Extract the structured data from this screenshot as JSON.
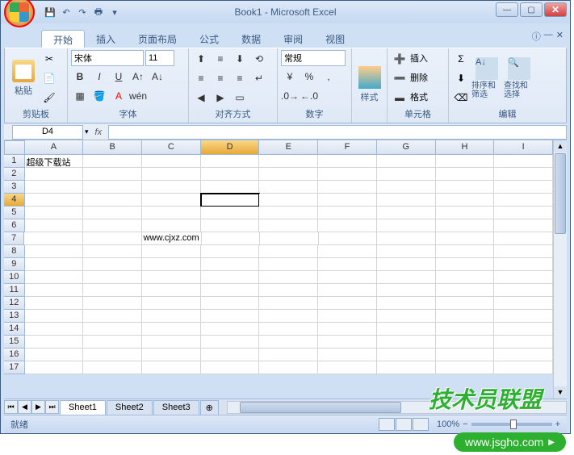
{
  "title": "Book1 - Microsoft Excel",
  "tabs": {
    "home": "开始",
    "insert": "插入",
    "pagelayout": "页面布局",
    "formulas": "公式",
    "data": "数据",
    "review": "审阅",
    "view": "视图"
  },
  "ribbon": {
    "clipboard": {
      "paste": "粘贴",
      "label": "剪贴板"
    },
    "font": {
      "name": "宋体",
      "size": "11",
      "label": "字体"
    },
    "alignment": {
      "label": "对齐方式"
    },
    "number": {
      "format": "常规",
      "label": "数字"
    },
    "styles": {
      "btn": "样式",
      "label": ""
    },
    "cells": {
      "insert": "插入",
      "delete": "删除",
      "format": "格式",
      "label": "单元格"
    },
    "editing": {
      "sort": "排序和筛选",
      "find": "查找和选择",
      "label": "编辑"
    }
  },
  "namebox": "D4",
  "columns": [
    "A",
    "B",
    "C",
    "D",
    "E",
    "F",
    "G",
    "H",
    "I"
  ],
  "row_count": 17,
  "cells": {
    "A1": "超级下载站",
    "C7": "www.cjxz.com"
  },
  "active_cell": "D4",
  "active_col": "D",
  "active_row": 4,
  "sheets": [
    "Sheet1",
    "Sheet2",
    "Sheet3"
  ],
  "active_sheet": 0,
  "status": "就绪",
  "zoom": "100%",
  "watermark1": "技术员联盟",
  "watermark2": "www.jsgho.com"
}
